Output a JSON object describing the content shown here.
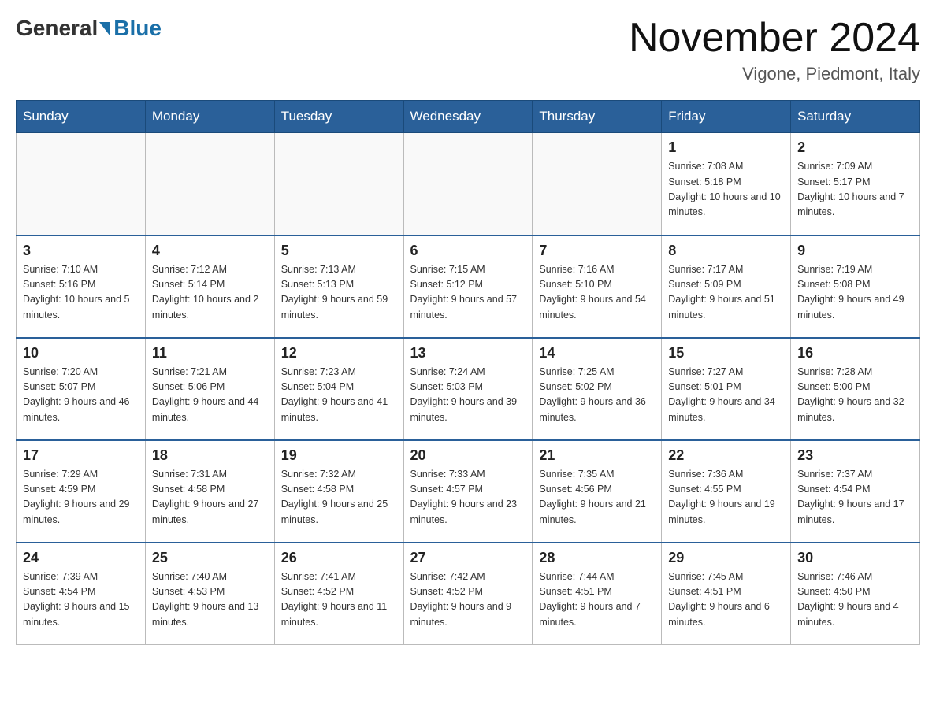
{
  "header": {
    "logo_general": "General",
    "logo_blue": "Blue",
    "title": "November 2024",
    "subtitle": "Vigone, Piedmont, Italy"
  },
  "days_of_week": [
    "Sunday",
    "Monday",
    "Tuesday",
    "Wednesday",
    "Thursday",
    "Friday",
    "Saturday"
  ],
  "weeks": [
    [
      {
        "day": "",
        "sunrise": "",
        "sunset": "",
        "daylight": ""
      },
      {
        "day": "",
        "sunrise": "",
        "sunset": "",
        "daylight": ""
      },
      {
        "day": "",
        "sunrise": "",
        "sunset": "",
        "daylight": ""
      },
      {
        "day": "",
        "sunrise": "",
        "sunset": "",
        "daylight": ""
      },
      {
        "day": "",
        "sunrise": "",
        "sunset": "",
        "daylight": ""
      },
      {
        "day": "1",
        "sunrise": "Sunrise: 7:08 AM",
        "sunset": "Sunset: 5:18 PM",
        "daylight": "Daylight: 10 hours and 10 minutes."
      },
      {
        "day": "2",
        "sunrise": "Sunrise: 7:09 AM",
        "sunset": "Sunset: 5:17 PM",
        "daylight": "Daylight: 10 hours and 7 minutes."
      }
    ],
    [
      {
        "day": "3",
        "sunrise": "Sunrise: 7:10 AM",
        "sunset": "Sunset: 5:16 PM",
        "daylight": "Daylight: 10 hours and 5 minutes."
      },
      {
        "day": "4",
        "sunrise": "Sunrise: 7:12 AM",
        "sunset": "Sunset: 5:14 PM",
        "daylight": "Daylight: 10 hours and 2 minutes."
      },
      {
        "day": "5",
        "sunrise": "Sunrise: 7:13 AM",
        "sunset": "Sunset: 5:13 PM",
        "daylight": "Daylight: 9 hours and 59 minutes."
      },
      {
        "day": "6",
        "sunrise": "Sunrise: 7:15 AM",
        "sunset": "Sunset: 5:12 PM",
        "daylight": "Daylight: 9 hours and 57 minutes."
      },
      {
        "day": "7",
        "sunrise": "Sunrise: 7:16 AM",
        "sunset": "Sunset: 5:10 PM",
        "daylight": "Daylight: 9 hours and 54 minutes."
      },
      {
        "day": "8",
        "sunrise": "Sunrise: 7:17 AM",
        "sunset": "Sunset: 5:09 PM",
        "daylight": "Daylight: 9 hours and 51 minutes."
      },
      {
        "day": "9",
        "sunrise": "Sunrise: 7:19 AM",
        "sunset": "Sunset: 5:08 PM",
        "daylight": "Daylight: 9 hours and 49 minutes."
      }
    ],
    [
      {
        "day": "10",
        "sunrise": "Sunrise: 7:20 AM",
        "sunset": "Sunset: 5:07 PM",
        "daylight": "Daylight: 9 hours and 46 minutes."
      },
      {
        "day": "11",
        "sunrise": "Sunrise: 7:21 AM",
        "sunset": "Sunset: 5:06 PM",
        "daylight": "Daylight: 9 hours and 44 minutes."
      },
      {
        "day": "12",
        "sunrise": "Sunrise: 7:23 AM",
        "sunset": "Sunset: 5:04 PM",
        "daylight": "Daylight: 9 hours and 41 minutes."
      },
      {
        "day": "13",
        "sunrise": "Sunrise: 7:24 AM",
        "sunset": "Sunset: 5:03 PM",
        "daylight": "Daylight: 9 hours and 39 minutes."
      },
      {
        "day": "14",
        "sunrise": "Sunrise: 7:25 AM",
        "sunset": "Sunset: 5:02 PM",
        "daylight": "Daylight: 9 hours and 36 minutes."
      },
      {
        "day": "15",
        "sunrise": "Sunrise: 7:27 AM",
        "sunset": "Sunset: 5:01 PM",
        "daylight": "Daylight: 9 hours and 34 minutes."
      },
      {
        "day": "16",
        "sunrise": "Sunrise: 7:28 AM",
        "sunset": "Sunset: 5:00 PM",
        "daylight": "Daylight: 9 hours and 32 minutes."
      }
    ],
    [
      {
        "day": "17",
        "sunrise": "Sunrise: 7:29 AM",
        "sunset": "Sunset: 4:59 PM",
        "daylight": "Daylight: 9 hours and 29 minutes."
      },
      {
        "day": "18",
        "sunrise": "Sunrise: 7:31 AM",
        "sunset": "Sunset: 4:58 PM",
        "daylight": "Daylight: 9 hours and 27 minutes."
      },
      {
        "day": "19",
        "sunrise": "Sunrise: 7:32 AM",
        "sunset": "Sunset: 4:58 PM",
        "daylight": "Daylight: 9 hours and 25 minutes."
      },
      {
        "day": "20",
        "sunrise": "Sunrise: 7:33 AM",
        "sunset": "Sunset: 4:57 PM",
        "daylight": "Daylight: 9 hours and 23 minutes."
      },
      {
        "day": "21",
        "sunrise": "Sunrise: 7:35 AM",
        "sunset": "Sunset: 4:56 PM",
        "daylight": "Daylight: 9 hours and 21 minutes."
      },
      {
        "day": "22",
        "sunrise": "Sunrise: 7:36 AM",
        "sunset": "Sunset: 4:55 PM",
        "daylight": "Daylight: 9 hours and 19 minutes."
      },
      {
        "day": "23",
        "sunrise": "Sunrise: 7:37 AM",
        "sunset": "Sunset: 4:54 PM",
        "daylight": "Daylight: 9 hours and 17 minutes."
      }
    ],
    [
      {
        "day": "24",
        "sunrise": "Sunrise: 7:39 AM",
        "sunset": "Sunset: 4:54 PM",
        "daylight": "Daylight: 9 hours and 15 minutes."
      },
      {
        "day": "25",
        "sunrise": "Sunrise: 7:40 AM",
        "sunset": "Sunset: 4:53 PM",
        "daylight": "Daylight: 9 hours and 13 minutes."
      },
      {
        "day": "26",
        "sunrise": "Sunrise: 7:41 AM",
        "sunset": "Sunset: 4:52 PM",
        "daylight": "Daylight: 9 hours and 11 minutes."
      },
      {
        "day": "27",
        "sunrise": "Sunrise: 7:42 AM",
        "sunset": "Sunset: 4:52 PM",
        "daylight": "Daylight: 9 hours and 9 minutes."
      },
      {
        "day": "28",
        "sunrise": "Sunrise: 7:44 AM",
        "sunset": "Sunset: 4:51 PM",
        "daylight": "Daylight: 9 hours and 7 minutes."
      },
      {
        "day": "29",
        "sunrise": "Sunrise: 7:45 AM",
        "sunset": "Sunset: 4:51 PM",
        "daylight": "Daylight: 9 hours and 6 minutes."
      },
      {
        "day": "30",
        "sunrise": "Sunrise: 7:46 AM",
        "sunset": "Sunset: 4:50 PM",
        "daylight": "Daylight: 9 hours and 4 minutes."
      }
    ]
  ]
}
